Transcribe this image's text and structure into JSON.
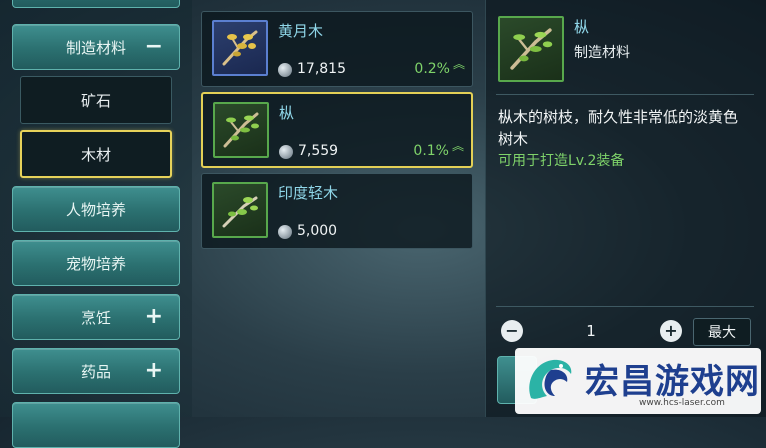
{
  "categories": [
    {
      "label": "制造材料",
      "toggle": "−"
    },
    {
      "label": "人物培养"
    },
    {
      "label": "宠物培养"
    },
    {
      "label": "烹饪",
      "toggle": "+"
    },
    {
      "label": "药品",
      "toggle": "+"
    }
  ],
  "subcategories": [
    {
      "label": "矿石"
    },
    {
      "label": "木材"
    }
  ],
  "items": [
    {
      "name": "黄月木",
      "price": "17,815",
      "change": "0.2%",
      "icon": "golden-branch-icon"
    },
    {
      "name": "枞",
      "price": "7,559",
      "change": "0.1%",
      "icon": "fir-branch-icon"
    },
    {
      "name": "印度轻木",
      "price": "5,000",
      "icon": "balsa-branch-icon"
    }
  ],
  "detail": {
    "name": "枞",
    "type": "制造材料",
    "description": "枞木的树枝，耐久性非常低的淡黄色树木",
    "usage": "可用于打造Lv.2装备"
  },
  "quantity": {
    "minus": "−",
    "value": "1",
    "plus": "+",
    "max_label": "最大"
  },
  "watermark": {
    "title": "宏昌游戏网",
    "url": "www.hcs-laser.com"
  },
  "colors": {
    "accent_teal": "#2b7070",
    "selected_gold": "#e3d056",
    "rarity_blue": "#5b7fd0",
    "rarity_green": "#58a84c",
    "gain_green": "#7fd36a",
    "name_cyan": "#8fd6e8"
  }
}
